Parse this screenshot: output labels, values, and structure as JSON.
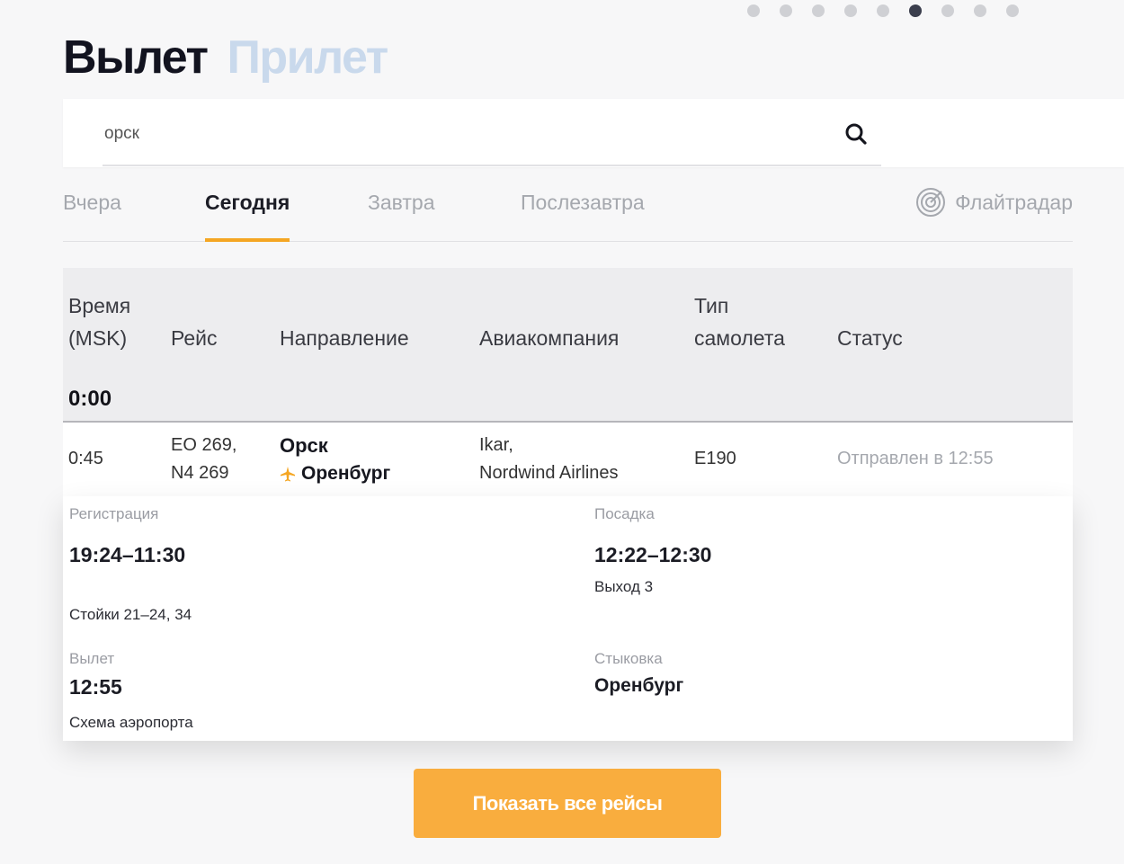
{
  "pager": {
    "count": 9,
    "active_index": 5
  },
  "mode_tabs": [
    {
      "label": "Вылет",
      "active": true
    },
    {
      "label": "Прилет",
      "active": false
    }
  ],
  "search": {
    "value": "орск"
  },
  "day_tabs": [
    {
      "label": "Вчера",
      "active": false
    },
    {
      "label": "Сегодня",
      "active": true
    },
    {
      "label": "Завтра",
      "active": false
    },
    {
      "label": "Послезавтра",
      "active": false
    }
  ],
  "flightradar": {
    "label": "Флайтрадар",
    "icon": "radar-icon"
  },
  "table": {
    "headers": {
      "time_line1": "Время",
      "time_line2": "(MSK)",
      "flight": "Рейс",
      "direction": "Направление",
      "airline": "Авиакомпания",
      "aircraft_line1": "Тип",
      "aircraft_line2": "самолета",
      "status": "Статус"
    },
    "group_time": "0:00",
    "rows": [
      {
        "time": "0:45",
        "flight_line1": "EO 269,",
        "flight_line2": "N4 269",
        "destination": "Орск",
        "connection": "Оренбург",
        "airline_line1": "Ikar,",
        "airline_line2": "Nordwind Airlines",
        "aircraft": "E190",
        "status": "Отправлен в 12:55"
      }
    ]
  },
  "details": {
    "checkin_label": "Регистрация",
    "checkin_time": "19:24–11:30",
    "checkin_desks": "Стойки 21–24, 34",
    "boarding_label": "Посадка",
    "boarding_time": "12:22–12:30",
    "boarding_gate": "Выход 3",
    "departure_label": "Вылет",
    "departure_time": "12:55",
    "airport_map": "Схема аэропорта",
    "connection_label": "Стыковка",
    "connection_city": "Оренбург"
  },
  "show_all_button": "Показать все рейсы",
  "colors": {
    "accent": "#f5a623",
    "button": "#f9ad3e",
    "inactive_mode": "#c9d9ec"
  }
}
